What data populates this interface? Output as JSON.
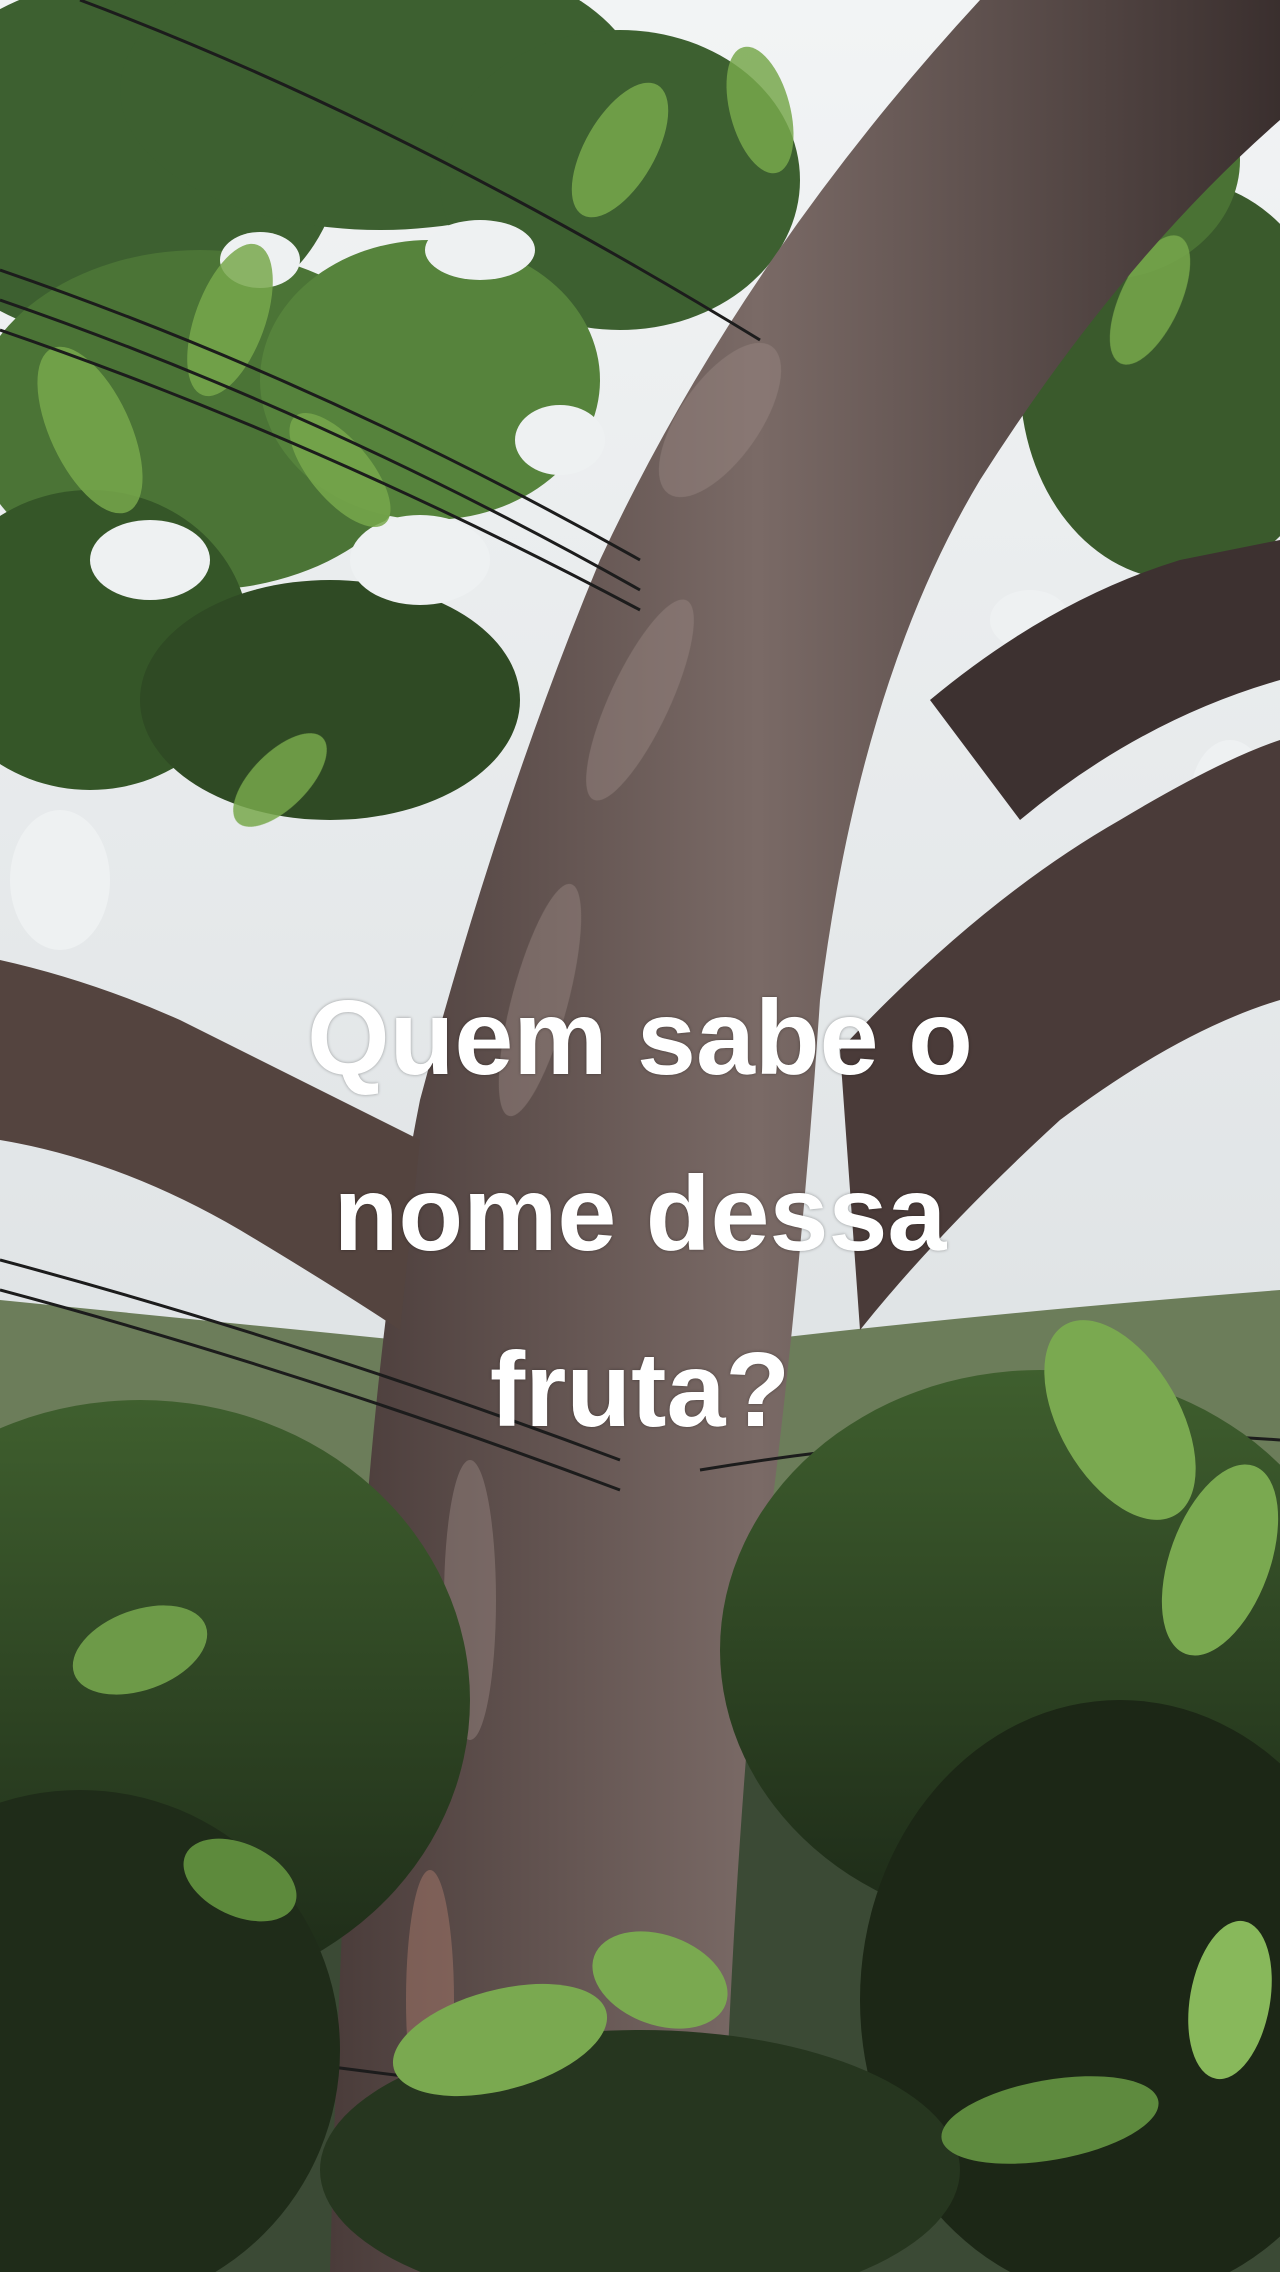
{
  "caption": {
    "lines": [
      "Quem sabe o",
      "nome dessa",
      "fruta?"
    ]
  },
  "colors": {
    "sky": "#e9ecee",
    "trunk": "#5b4a45",
    "trunk_shadow": "#3a2f2e",
    "leaf_dark": "#2f4a24",
    "leaf_mid": "#4f7a35",
    "leaf_light": "#8dbf5f",
    "caption_text": "#ffffff"
  }
}
